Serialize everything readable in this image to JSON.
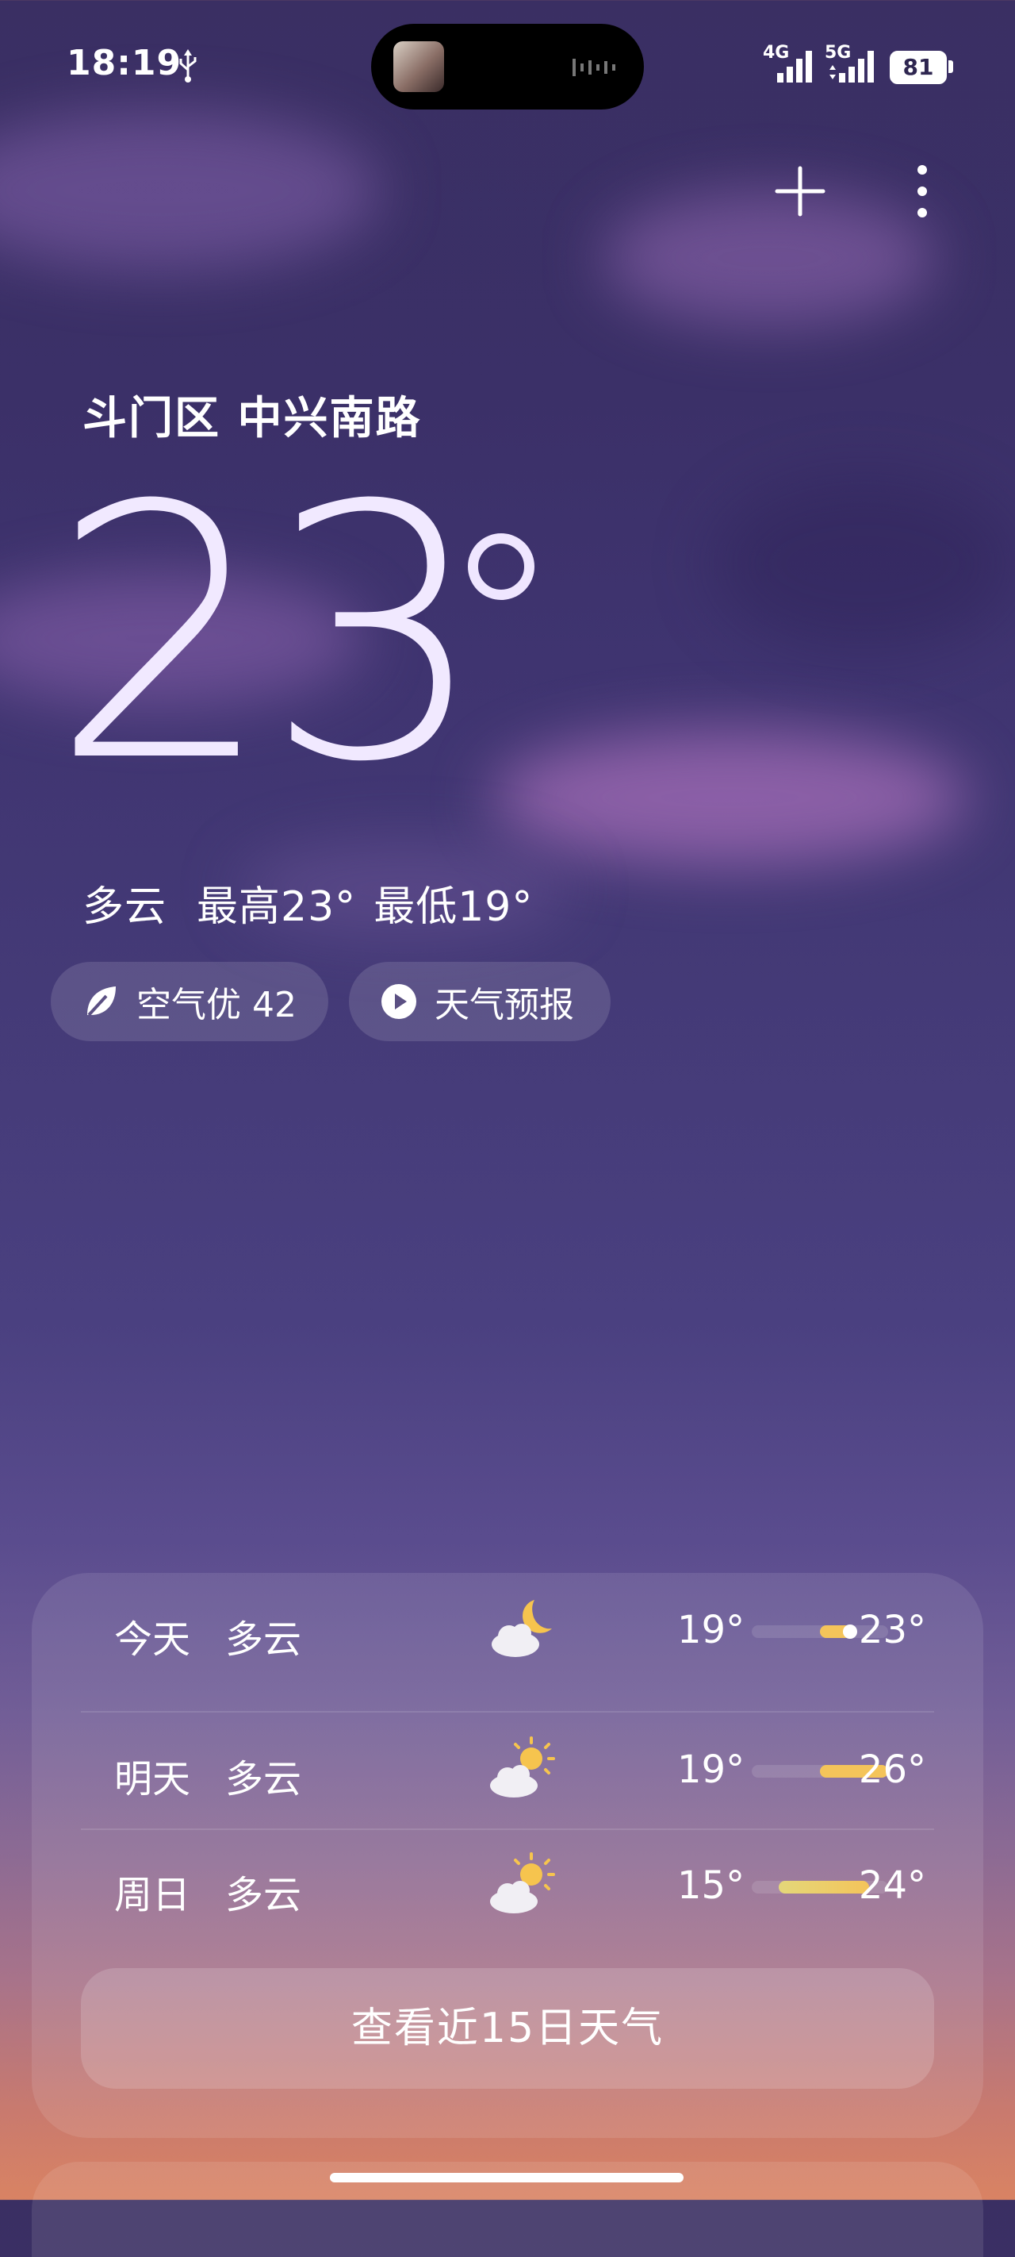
{
  "status_bar": {
    "time": "18:19",
    "signal_1_label": "4G",
    "signal_2_label": "5G",
    "battery_level": "81"
  },
  "location": "斗门区 中兴南路",
  "current": {
    "temperature": "23",
    "condition": "多云",
    "high": "最高23°",
    "low": "最低19°"
  },
  "chips": {
    "aqi_label": "空气优 42",
    "forecast_label": "天气预报"
  },
  "daily": [
    {
      "day": "今天",
      "condition": "多云",
      "icon": "cloudy-night-icon",
      "low": "19°",
      "high": "23°",
      "range_start": 0.5,
      "range_end": 0.75,
      "current_pos": 0.72
    },
    {
      "day": "明天",
      "condition": "多云",
      "icon": "partly-cloudy-icon",
      "low": "19°",
      "high": "26°",
      "range_start": 0.5,
      "range_end": 1.0
    },
    {
      "day": "周日",
      "condition": "多云",
      "icon": "partly-cloudy-icon",
      "low": "15°",
      "high": "24°",
      "range_start": 0.2,
      "range_end": 0.86
    }
  ],
  "more_button": "查看近15日天气",
  "colors": {
    "accent_yellow": "#f4c45a",
    "bg_top": "#3a2f63",
    "bg_bottom": "#d98363"
  }
}
